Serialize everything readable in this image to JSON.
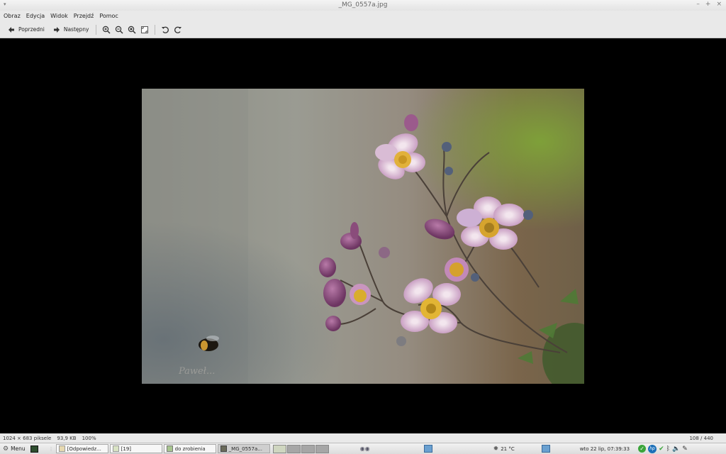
{
  "window": {
    "title": "_MG_0557a.jpg"
  },
  "menu": [
    "Obraz",
    "Edycja",
    "Widok",
    "Przejdź",
    "Pomoc"
  ],
  "toolbar": {
    "prev_label": "Poprzedni",
    "next_label": "Następny"
  },
  "photo": {
    "watermark": "Paweł..."
  },
  "status": {
    "dimensions": "1024 × 683 piksele",
    "size": "93,9 KB",
    "zoom": "100%",
    "position": "108 / 440"
  },
  "taskbar": {
    "menu_label": "Menu",
    "tasks": [
      "[Odpowiedz...",
      "[19]",
      "do zrobienia",
      "_MG_0557a..."
    ],
    "weather": "21 °C",
    "datetime": "wto 22 lip, 07:39:33"
  },
  "colors": {
    "bar_bg": "#e9e9e9",
    "viewer_bg": "#000000",
    "tray_green": "#3aa53a",
    "hp_blue": "#1b6fb8"
  }
}
